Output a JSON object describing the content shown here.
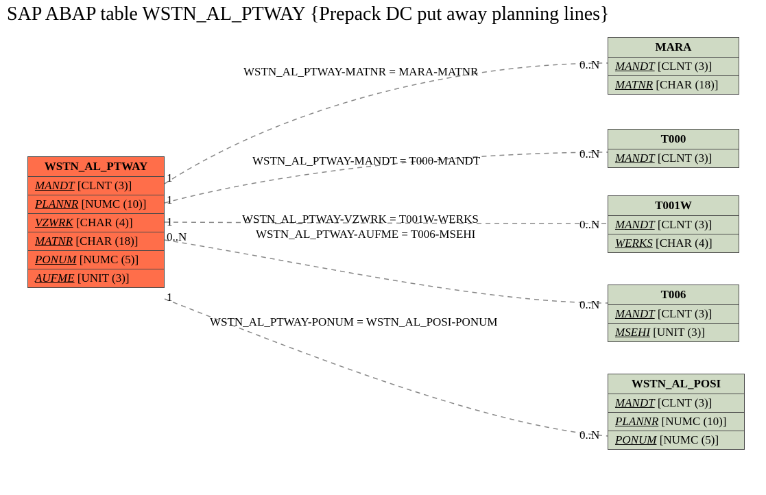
{
  "title": "SAP ABAP table WSTN_AL_PTWAY {Prepack DC put away planning lines}",
  "main": {
    "name": "WSTN_AL_PTWAY",
    "fields": [
      {
        "fld": "MANDT",
        "typ": " [CLNT (3)]"
      },
      {
        "fld": "PLANNR",
        "typ": " [NUMC (10)]"
      },
      {
        "fld": "VZWRK",
        "typ": " [CHAR (4)]"
      },
      {
        "fld": "MATNR",
        "typ": " [CHAR (18)]"
      },
      {
        "fld": "PONUM",
        "typ": " [NUMC (5)]"
      },
      {
        "fld": "AUFME",
        "typ": " [UNIT (3)]"
      }
    ]
  },
  "related": {
    "mara": {
      "name": "MARA",
      "fields": [
        {
          "fld": "MANDT",
          "typ": " [CLNT (3)]"
        },
        {
          "fld": "MATNR",
          "typ": " [CHAR (18)]"
        }
      ]
    },
    "t000": {
      "name": "T000",
      "fields": [
        {
          "fld": "MANDT",
          "typ": " [CLNT (3)]"
        }
      ]
    },
    "t001w": {
      "name": "T001W",
      "fields": [
        {
          "fld": "MANDT",
          "typ": " [CLNT (3)]"
        },
        {
          "fld": "WERKS",
          "typ": " [CHAR (4)]"
        }
      ]
    },
    "t006": {
      "name": "T006",
      "fields": [
        {
          "fld": "MANDT",
          "typ": " [CLNT (3)]"
        },
        {
          "fld": "MSEHI",
          "typ": " [UNIT (3)]"
        }
      ]
    },
    "posi": {
      "name": "WSTN_AL_POSI",
      "fields": [
        {
          "fld": "MANDT",
          "typ": " [CLNT (3)]"
        },
        {
          "fld": "PLANNR",
          "typ": " [NUMC (10)]"
        },
        {
          "fld": "PONUM",
          "typ": " [NUMC (5)]"
        }
      ]
    }
  },
  "relations": [
    {
      "label": "WSTN_AL_PTWAY-MATNR = MARA-MATNR",
      "src_card": "1",
      "dst_card": "0..N"
    },
    {
      "label": "WSTN_AL_PTWAY-MANDT = T000-MANDT",
      "src_card": "1",
      "dst_card": "0..N"
    },
    {
      "label": "WSTN_AL_PTWAY-VZWRK = T001W-WERKS",
      "src_card": "1",
      "dst_card": "0..N"
    },
    {
      "label": "WSTN_AL_PTWAY-AUFME = T006-MSEHI",
      "src_card": "0..N",
      "dst_card": "0..N"
    },
    {
      "label": "WSTN_AL_PTWAY-PONUM = WSTN_AL_POSI-PONUM",
      "src_card": "1",
      "dst_card": "0..N"
    }
  ]
}
